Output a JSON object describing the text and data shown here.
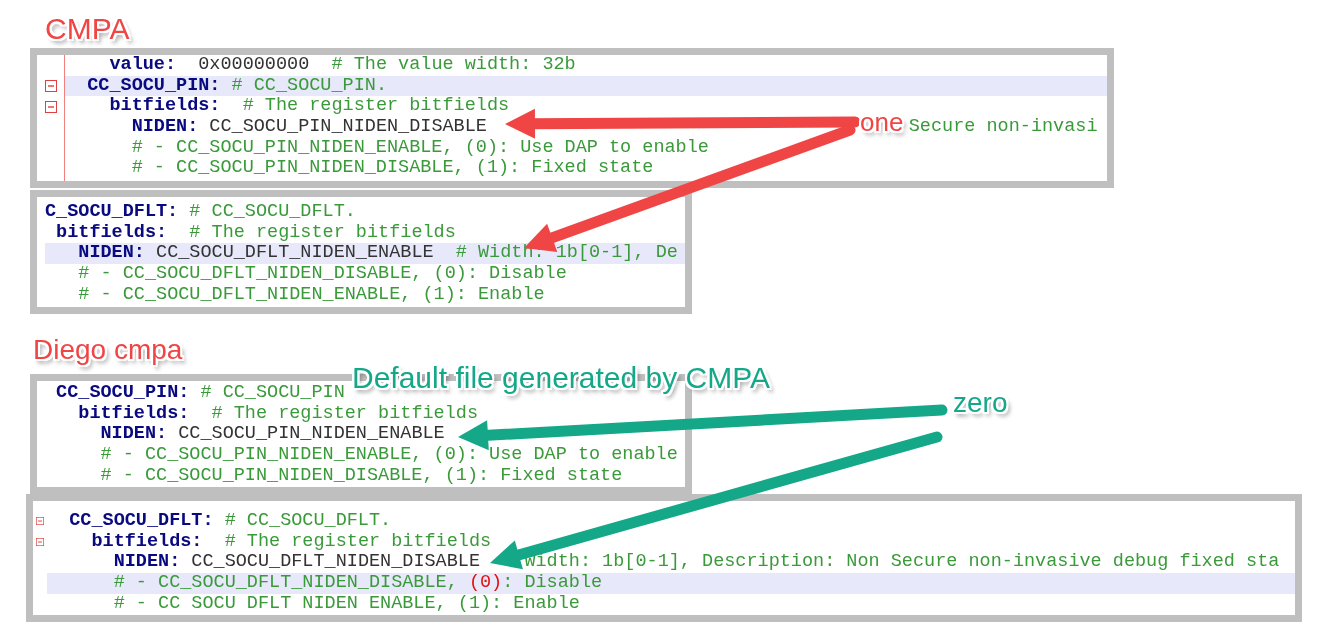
{
  "annotations": [
    {
      "text": "CMPA",
      "color": "#f04545"
    },
    {
      "text": "one",
      "color": "#f04545"
    },
    {
      "text": "Diego cmpa",
      "color": "#f04545"
    },
    {
      "text": "Default file generated by CMPA",
      "color": "#14a889"
    },
    {
      "text": "zero",
      "color": "#14a889"
    }
  ],
  "snippets": [
    {
      "gutter": true,
      "lines": [
        {
          "current": false,
          "fold": false,
          "segments": [
            {
              "kind": "key",
              "text": "    value:"
            },
            {
              "kind": "value",
              "text": "  0x00000000"
            },
            {
              "kind": "comment",
              "text": "  # The value width: 32b"
            }
          ]
        },
        {
          "current": true,
          "fold": true,
          "segments": [
            {
              "kind": "key",
              "text": "  CC_SOCU_PIN:"
            },
            {
              "kind": "comment",
              "text": " # CC_SOCU_PIN."
            }
          ]
        },
        {
          "current": false,
          "fold": true,
          "segments": [
            {
              "kind": "key",
              "text": "    bitfields:"
            },
            {
              "kind": "comment",
              "text": "  # The register bitfields"
            }
          ]
        },
        {
          "current": false,
          "fold": false,
          "segments": [
            {
              "kind": "key",
              "text": "      NIDEN:"
            },
            {
              "kind": "value",
              "text": " CC_SOCU_PIN_NIDEN_DISABLE"
            },
            {
              "kind": "comment",
              "text": "Secure non-invasi"
            }
          ]
        },
        {
          "current": false,
          "fold": false,
          "segments": [
            {
              "kind": "comment",
              "text": "      # - CC_SOCU_PIN_NIDEN_ENABLE, (0): Use DAP to enable"
            }
          ]
        },
        {
          "current": false,
          "fold": false,
          "segments": [
            {
              "kind": "comment",
              "text": "      # - CC_SOCU_PIN_NIDEN_DISABLE, (1): Fixed state"
            }
          ]
        }
      ]
    },
    {
      "gutter": false,
      "lines": [
        {
          "current": false,
          "segments": [
            {
              "kind": "key",
              "text": "C_SOCU_DFLT:"
            },
            {
              "kind": "comment",
              "text": " # CC_SOCU_DFLT."
            }
          ]
        },
        {
          "current": false,
          "segments": [
            {
              "kind": "key",
              "text": " bitfields:"
            },
            {
              "kind": "comment",
              "text": "  # The register bitfields"
            }
          ]
        },
        {
          "current": true,
          "segments": [
            {
              "kind": "key",
              "text": "   NIDEN:"
            },
            {
              "kind": "value",
              "text": " CC_SOCU_DFLT_NIDEN_ENABLE"
            },
            {
              "kind": "comment",
              "text": "  # Width: 1b[0-1], De"
            }
          ]
        },
        {
          "current": false,
          "segments": [
            {
              "kind": "comment",
              "text": "   # - CC_SOCU_DFLT_NIDEN_DISABLE, (0): Disable"
            }
          ]
        },
        {
          "current": false,
          "segments": [
            {
              "kind": "comment",
              "text": "   # - CC_SOCU_DFLT_NIDEN_ENABLE, (1): Enable"
            }
          ]
        }
      ]
    },
    {
      "gutter": false,
      "lines": [
        {
          "current": false,
          "segments": [
            {
              "kind": "key",
              "text": " CC_SOCU_PIN:"
            },
            {
              "kind": "comment",
              "text": " # CC_SOCU_PIN"
            }
          ]
        },
        {
          "current": false,
          "segments": [
            {
              "kind": "key",
              "text": "   bitfields:"
            },
            {
              "kind": "comment",
              "text": "  # The register bitfields"
            }
          ]
        },
        {
          "current": false,
          "segments": [
            {
              "kind": "key",
              "text": "     NIDEN:"
            },
            {
              "kind": "value",
              "text": " CC_SOCU_PIN_NIDEN_ENABLE"
            }
          ]
        },
        {
          "current": false,
          "segments": [
            {
              "kind": "comment",
              "text": "     # - CC_SOCU_PIN_NIDEN_ENABLE, (0): Use DAP to enable"
            }
          ]
        },
        {
          "current": false,
          "segments": [
            {
              "kind": "comment",
              "text": "     # - CC_SOCU_PIN_NIDEN_DISABLE, (1): Fixed state"
            }
          ]
        }
      ]
    },
    {
      "gutter": true,
      "lines": [
        {
          "current": false,
          "fold": true,
          "segments": [
            {
              "kind": "key",
              "text": "  CC_SOCU_DFLT:"
            },
            {
              "kind": "comment",
              "text": " # CC_SOCU_DFLT."
            }
          ]
        },
        {
          "current": false,
          "fold": true,
          "segments": [
            {
              "kind": "key",
              "text": "    bitfields:"
            },
            {
              "kind": "comment",
              "text": "  # The register bitfields"
            }
          ]
        },
        {
          "current": false,
          "fold": false,
          "segments": [
            {
              "kind": "key",
              "text": "      NIDEN:"
            },
            {
              "kind": "value",
              "text": " CC_SOCU_DFLT_NIDEN_DISABLE"
            },
            {
              "kind": "comment",
              "text": "Width: 1b[0-1], Description: Non Secure non-invasive debug fixed sta"
            }
          ]
        },
        {
          "current": true,
          "fold": false,
          "segments": [
            {
              "kind": "comment",
              "text": "      # - CC_SOCU_DFLT_NIDEN_DISABLE, "
            },
            {
              "kind": "bracket",
              "text": "(0)"
            },
            {
              "kind": "comment",
              "text": ": Disable"
            }
          ]
        },
        {
          "current": false,
          "fold": false,
          "segments": [
            {
              "kind": "comment",
              "text": "      # - CC SOCU DFLT NIDEN ENABLE, (1): Enable"
            }
          ]
        }
      ]
    }
  ]
}
